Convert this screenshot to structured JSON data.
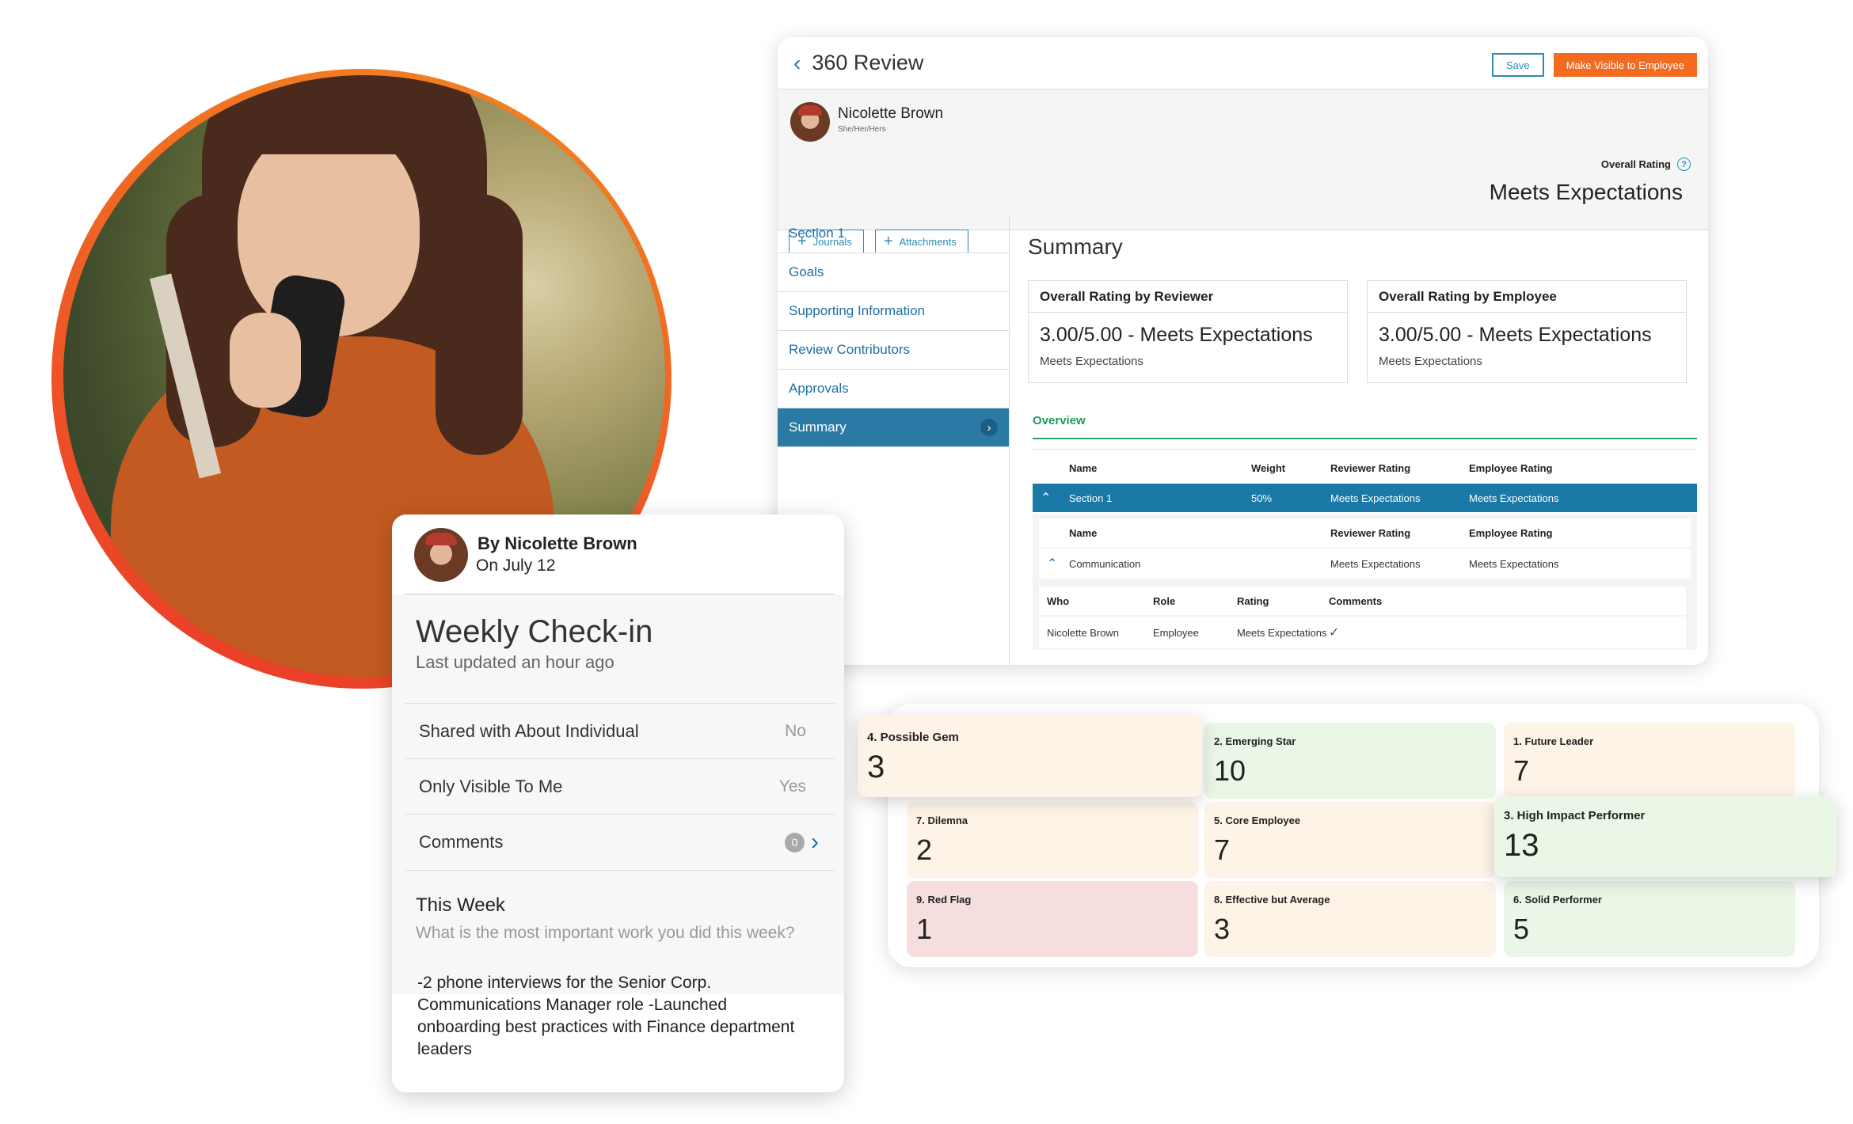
{
  "review": {
    "title": "360 Review",
    "save_label": "Save",
    "visible_label": "Make Visible to Employee",
    "person_name": "Nicolette Brown",
    "pronouns": "She/Her/Hers",
    "overall_rating_label": "Overall Rating",
    "overall_rating_value": "Meets Expectations",
    "journals_label": "Journals",
    "attachments_label": "Attachments",
    "nav": [
      "Section 1",
      "Goals",
      "Supporting Information",
      "Review Contributors",
      "Approvals",
      "Summary"
    ],
    "summary_title": "Summary",
    "reviewer_card": {
      "title": "Overall Rating by Reviewer",
      "value": "3.00/5.00 - Meets Expectations",
      "sub": "Meets Expectations"
    },
    "employee_card": {
      "title": "Overall Rating by Employee",
      "value": "3.00/5.00 - Meets Expectations",
      "sub": "Meets Expectations"
    },
    "overview_tab": "Overview",
    "table_headers": [
      "Name",
      "Weight",
      "Reviewer Rating",
      "Employee Rating"
    ],
    "section_row": [
      "Section 1",
      "50%",
      "Meets Expectations",
      "Meets Expectations"
    ],
    "sub_headers": [
      "Name",
      "Reviewer Rating",
      "Employee Rating"
    ],
    "sub_row": [
      "Communication",
      "Meets Expectations",
      "Meets Expectations"
    ],
    "who_headers": [
      "Who",
      "Role",
      "Rating",
      "Comments"
    ],
    "who_row": [
      "Nicolette Brown",
      "Employee",
      "Meets Expectations"
    ]
  },
  "checkin": {
    "by": "By Nicolette Brown",
    "on": "On July 12",
    "title": "Weekly Check-in",
    "updated": "Last updated an hour ago",
    "shared_label": "Shared with About Individual",
    "shared_value": "No",
    "only_visible_label": "Only Visible To Me",
    "only_visible_value": "Yes",
    "comments_label": "Comments",
    "comments_count": "0",
    "week_title": "This Week",
    "week_question": "What is the most important work you did this week?",
    "week_answer": "-2 phone interviews for the Senior Corp. Communications Manager role -Launched onboarding best practices with Finance department leaders"
  },
  "ninebox": {
    "cells": [
      {
        "label": "4. Possible Gem",
        "value": "3"
      },
      {
        "label": "2. Emerging Star",
        "value": "10"
      },
      {
        "label": "1. Future Leader",
        "value": "7"
      },
      {
        "label": "7. Dilemna",
        "value": "2"
      },
      {
        "label": "5. Core Employee",
        "value": "7"
      },
      {
        "label": "3. High Impact Performer",
        "value": "13"
      },
      {
        "label": "9. Red Flag",
        "value": "1"
      },
      {
        "label": "8. Effective but Average",
        "value": "3"
      },
      {
        "label": "6. Solid Performer",
        "value": "5"
      }
    ]
  },
  "colors": {
    "accent_blue": "#2b7aa5",
    "accent_orange": "#f26b21",
    "overview_green": "#2aa66a"
  }
}
